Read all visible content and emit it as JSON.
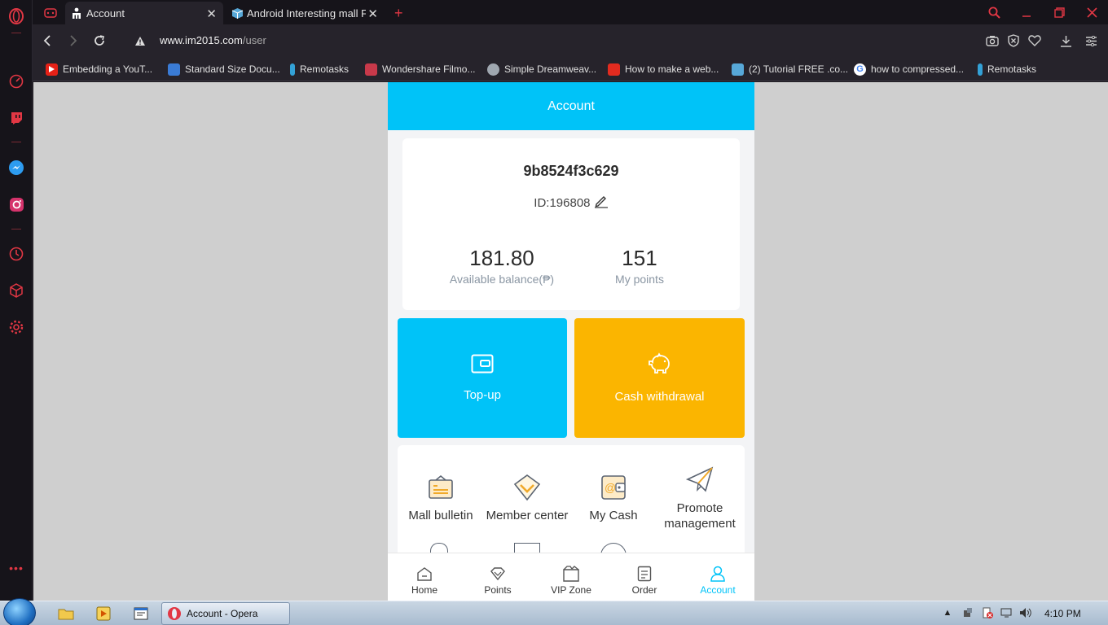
{
  "browser": {
    "tabs": [
      {
        "title": "Account",
        "active": true
      },
      {
        "title": "Android Interesting mall Fa",
        "active": false
      }
    ],
    "url_host": "www.im2015.com",
    "url_path": "/user",
    "bookmarks": [
      {
        "label": "Embedding a YouT...",
        "icon": "youtube-icon",
        "color": "#e62117"
      },
      {
        "label": "Standard Size Docu...",
        "icon": "doc-icon",
        "color": "#3a7bd5"
      },
      {
        "label": "Remotasks",
        "icon": "remotasks-icon",
        "color": "#33a1d6"
      },
      {
        "label": "Wondershare Filmo...",
        "icon": "filmora-icon",
        "color": "#c8394a"
      },
      {
        "label": "Simple Dreamweav...",
        "icon": "dreamweaver-icon",
        "color": "#9fa7b0"
      },
      {
        "label": "How to make a web...",
        "icon": "adobe-icon",
        "color": "#e22b1f"
      },
      {
        "label": "(2) Tutorial FREE .co...",
        "icon": "cube-icon",
        "color": "#57a8d8"
      },
      {
        "label": "how to compressed...",
        "icon": "google-icon",
        "color": "#4285f4"
      },
      {
        "label": "Remotasks",
        "icon": "remotasks-icon",
        "color": "#33a1d6"
      }
    ]
  },
  "page": {
    "header_title": "Account",
    "username": "9b8524f3c629",
    "user_id": "ID:196808",
    "balance": "181.80",
    "balance_label": "Available balance(₱)",
    "points": "151",
    "points_label": "My points",
    "topup_label": "Top-up",
    "cash_label": "Cash withdrawal",
    "menu": {
      "mall_bulletin": "Mall bulletin",
      "member_center": "Member center",
      "my_cash": "My Cash",
      "promote_management": "Promote management"
    },
    "tabbar": {
      "home": "Home",
      "points": "Points",
      "vip": "VIP Zone",
      "order": "Order",
      "account": "Account"
    },
    "accent_color": "#00c3f8",
    "cash_color": "#fbb500"
  },
  "taskbar": {
    "task_label": "Account - Opera",
    "time": "4:10 PM"
  }
}
